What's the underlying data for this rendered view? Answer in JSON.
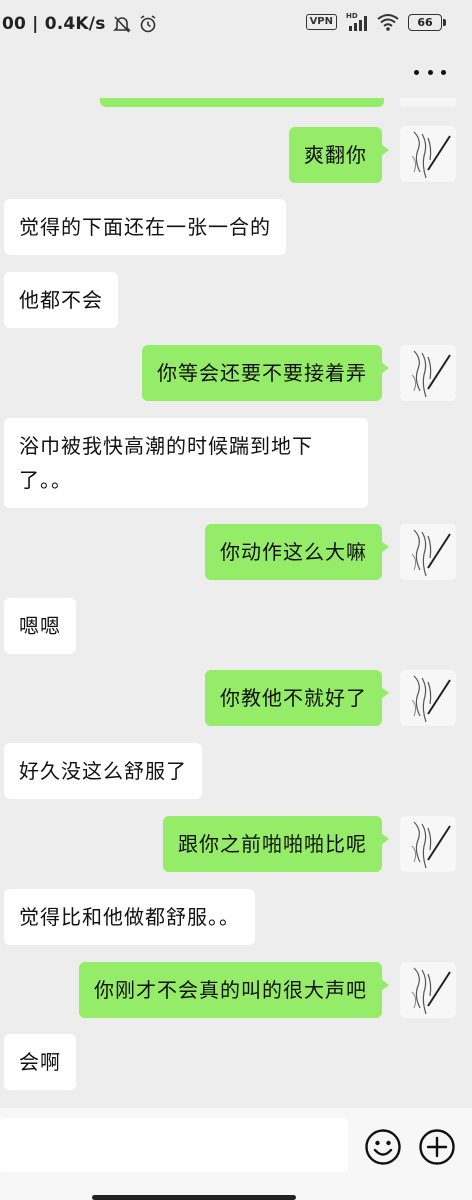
{
  "status_bar": {
    "left_text": "00 | 0.4K/s",
    "vpn_label": "VPN",
    "network_label": "HD",
    "battery_level": "66"
  },
  "header": {
    "more_icon": "more-dots-icon"
  },
  "messages": [
    {
      "side": "out",
      "text": "爽翻你"
    },
    {
      "side": "in",
      "text": "觉得的下面还在一张一合的"
    },
    {
      "side": "in",
      "text": "他都不会"
    },
    {
      "side": "out",
      "text": "你等会还要不要接着弄"
    },
    {
      "side": "in",
      "text": "浴巾被我快高潮的时候踹到地下了。。"
    },
    {
      "side": "out",
      "text": "你动作这么大嘛"
    },
    {
      "side": "in",
      "text": "嗯嗯"
    },
    {
      "side": "out",
      "text": "你教他不就好了"
    },
    {
      "side": "in",
      "text": "好久没这么舒服了"
    },
    {
      "side": "out",
      "text": "跟你之前啪啪啪比呢"
    },
    {
      "side": "in",
      "text": "觉得比和他做都舒服。。"
    },
    {
      "side": "out",
      "text": "你刚才不会真的叫的很大声吧"
    },
    {
      "side": "in",
      "text": "会啊"
    }
  ],
  "input_bar": {
    "value": "",
    "emoji_icon": "emoji-icon",
    "plus_icon": "plus-icon"
  },
  "colors": {
    "background": "#ededed",
    "outgoing_bubble": "#95ec69",
    "incoming_bubble": "#ffffff"
  }
}
